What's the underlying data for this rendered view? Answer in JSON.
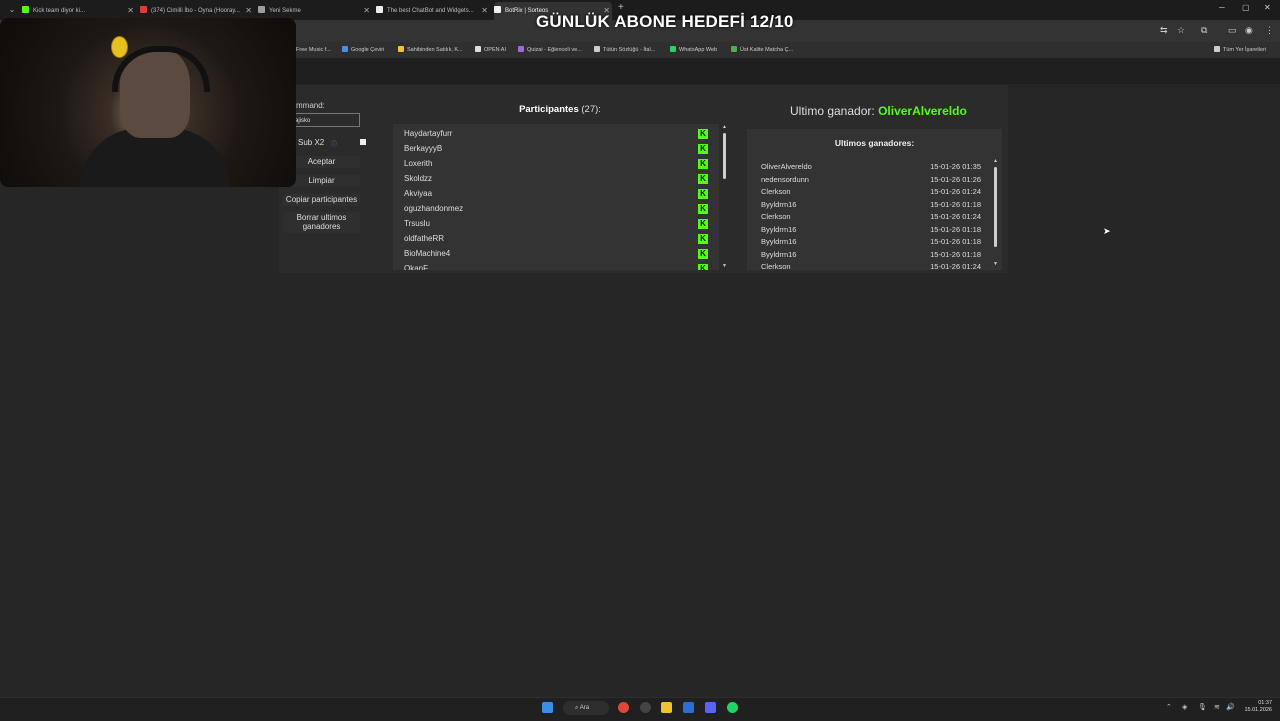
{
  "browser": {
    "tabs": [
      {
        "label": "Kick team diyor ki...",
        "color": "#53fc18",
        "active": false
      },
      {
        "label": "(374) Cimilli İbo - Oyna (Hooray...",
        "color": "#e53935",
        "active": false
      },
      {
        "label": "Yeni Sekme",
        "color": "#9e9e9e",
        "active": false
      },
      {
        "label": "The best ChatBot and Widgets...",
        "color": "#eeeeee",
        "active": false
      },
      {
        "label": "BotRix | Sorteos",
        "color": "#eeeeee",
        "active": true
      }
    ],
    "bookmarks": [
      "Free Music f...",
      "Google Çeviri",
      "Sahibinden Satılık, K...",
      "OPEN AI",
      "Quizai - Eğlenceli ve...",
      "Tütün Sözlüğü - İtal...",
      "WhatsApp Web",
      "Üst Kalite Matcha Ç...",
      "Tüm Yer İşaretleri"
    ]
  },
  "overlay": {
    "title": "GÜNLÜK ABONE HEDEFİ 12/10"
  },
  "controls": {
    "command_label": "mmand:",
    "command_value": "ajisko",
    "sub_label": "Sub X2",
    "accept": "Aceptar",
    "clear": "Limpiar",
    "copy": "Copiar participantes",
    "delete_winners": "Borrar ultimos ganadores"
  },
  "participants": {
    "title": "Participantes",
    "count": "(27):",
    "items": [
      "Haydartayfurr",
      "BerkayyyB",
      "Loxerith",
      "Skoldzz",
      "Akviyaa",
      "oguzhandonmez",
      "Trsuslu",
      "oldfatheRR",
      "BioMachine4",
      "OkanF"
    ]
  },
  "last_winner": {
    "label": "Ultimo ganador:",
    "name": "OliverAlvereldo"
  },
  "winners": {
    "title": "Ultimos ganadores:",
    "items": [
      {
        "name": "OliverAlvereldo",
        "date": "15-01-26 01:35"
      },
      {
        "name": "nedensordunn",
        "date": "15-01-26 01:26"
      },
      {
        "name": "Clerkson",
        "date": "15-01-26 01:24"
      },
      {
        "name": "Byyldrm16",
        "date": "15-01-26 01:18"
      },
      {
        "name": "Clerkson",
        "date": "15-01-26 01:24"
      },
      {
        "name": "Byyldrm16",
        "date": "15-01-26 01:18"
      },
      {
        "name": "Byyldrm16",
        "date": "15-01-26 01:18"
      },
      {
        "name": "Byyldrm16",
        "date": "15-01-26 01:18"
      },
      {
        "name": "Clerkson",
        "date": "15-01-26 01:24"
      }
    ]
  },
  "taskbar": {
    "search": "Ara",
    "time": "01:37",
    "date": "15.01.2026"
  },
  "colors": {
    "kick_green": "#53fc18",
    "winner_green": "#53fc18"
  }
}
